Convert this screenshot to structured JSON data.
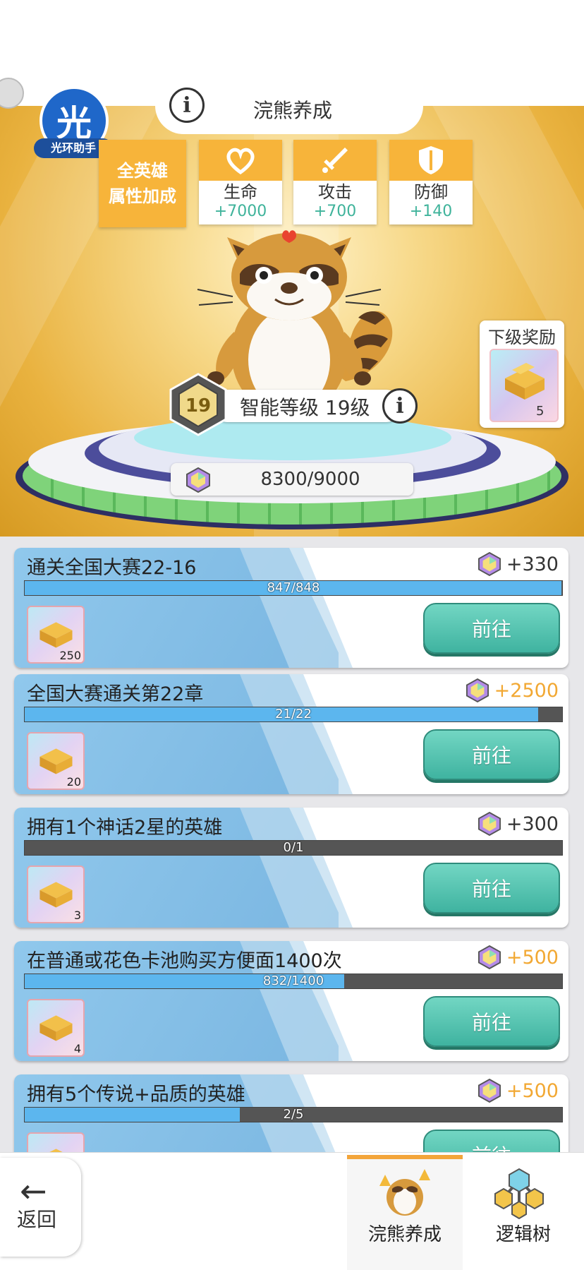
{
  "header": {
    "title": "浣熊养成",
    "info_icon": "i",
    "halo_helper": {
      "glyph": "光",
      "label": "光环助手"
    }
  },
  "bonus": {
    "label_line1": "全英雄",
    "label_line2": "属性加成",
    "stats": [
      {
        "name": "生命",
        "value": "+7000",
        "icon": "heart-icon"
      },
      {
        "name": "攻击",
        "value": "+700",
        "icon": "sword-icon"
      },
      {
        "name": "防御",
        "value": "+140",
        "icon": "shield-icon"
      }
    ]
  },
  "level": {
    "number": "19",
    "text": "智能等级 19级",
    "exp": "8300/9000"
  },
  "next_reward": {
    "label": "下级奖励",
    "count": "5"
  },
  "tasks": [
    {
      "title": "通关全国大赛22-16",
      "reward": "+330",
      "reward_color": "#333333",
      "progress": "847/848",
      "fill": 0.999,
      "item_count": "250",
      "button": "前往"
    },
    {
      "title": "全国大赛通关第22章",
      "reward": "+2500",
      "reward_color": "#f2a833",
      "progress": "21/22",
      "fill": 0.955,
      "item_count": "20",
      "button": "前往"
    },
    {
      "title": "拥有1个神话2星的英雄",
      "reward": "+300",
      "reward_color": "#333333",
      "progress": "0/1",
      "fill": 0.0,
      "item_count": "3",
      "button": "前往"
    },
    {
      "title": "在普通或花色卡池购买方便面1400次",
      "reward": "+500",
      "reward_color": "#f2a833",
      "progress": "832/1400",
      "fill": 0.594,
      "item_count": "4",
      "button": "前往"
    },
    {
      "title": "拥有5个传说+品质的英雄",
      "reward": "+500",
      "reward_color": "#f2a833",
      "progress": "2/5",
      "fill": 0.4,
      "item_count": "",
      "button": "前往"
    }
  ],
  "bottom_nav": {
    "back_label": "返回",
    "back_arrow": "←",
    "tabs": [
      {
        "label": "浣熊养成",
        "active": true
      },
      {
        "label": "逻辑树",
        "active": false
      }
    ]
  },
  "colors": {
    "accent": "#f7b43a",
    "button": "#3fb3a0",
    "progress": "#5cb6ee"
  }
}
